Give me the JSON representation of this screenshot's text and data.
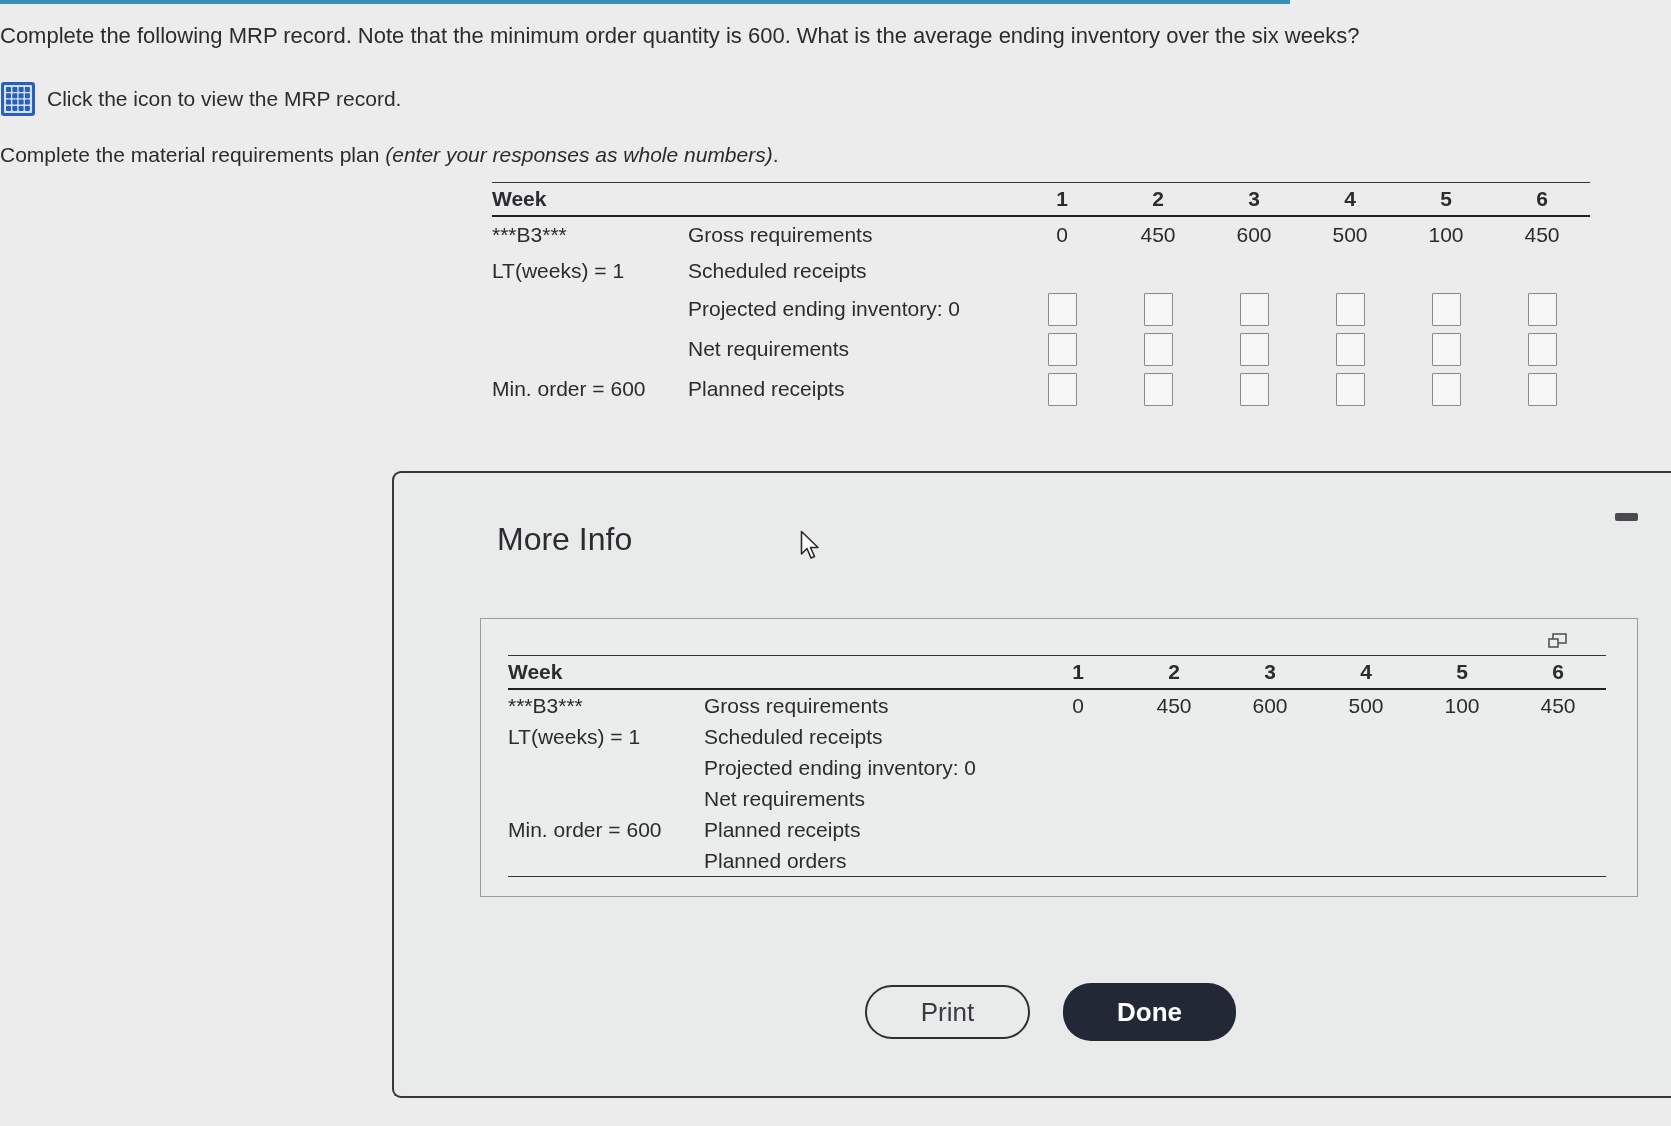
{
  "question": "Complete the following MRP record. Note that the minimum order quantity is 600. What is the average ending inventory over the six weeks?",
  "record_hint": {
    "text": "Click the icon to view the MRP record."
  },
  "instruction": "Complete the material requirements plan *(enter your responses as whole numbers)*.",
  "plan_table": {
    "header": "Week",
    "weeks": [
      "1",
      "2",
      "3",
      "4",
      "5",
      "6"
    ],
    "rows": [
      {
        "item": "***B3***",
        "label": "Gross requirements",
        "kind": "values",
        "values": [
          "0",
          "450",
          "600",
          "500",
          "100",
          "450"
        ]
      },
      {
        "item": "LT(weeks) = 1",
        "label": "Scheduled receipts",
        "kind": "blank"
      },
      {
        "label": "Projected ending inventory: 0",
        "kind": "inputs"
      },
      {
        "label": "Net requirements",
        "kind": "inputs"
      },
      {
        "item": "Min. order = 600",
        "label": "Planned receipts",
        "kind": "inputs"
      }
    ]
  },
  "more_info": {
    "title": "More Info",
    "table": {
      "header": "Week",
      "weeks": [
        "1",
        "2",
        "3",
        "4",
        "5",
        "6"
      ],
      "rows": [
        {
          "item": "***B3***",
          "label": "Gross requirements",
          "kind": "values",
          "values": [
            "0",
            "450",
            "600",
            "500",
            "100",
            "450"
          ]
        },
        {
          "item": "LT(weeks) = 1",
          "label": "Scheduled receipts",
          "kind": "blank"
        },
        {
          "label": "Projected ending inventory: 0",
          "kind": "blank"
        },
        {
          "label": "Net requirements",
          "kind": "blank"
        },
        {
          "item": "Min. order = 600",
          "label": "Planned receipts",
          "kind": "blank"
        },
        {
          "label": "Planned orders",
          "kind": "blank"
        }
      ]
    },
    "buttons": [
      {
        "label": "Print",
        "kind": "secondary"
      },
      {
        "label": "Done",
        "kind": "primary"
      }
    ]
  }
}
